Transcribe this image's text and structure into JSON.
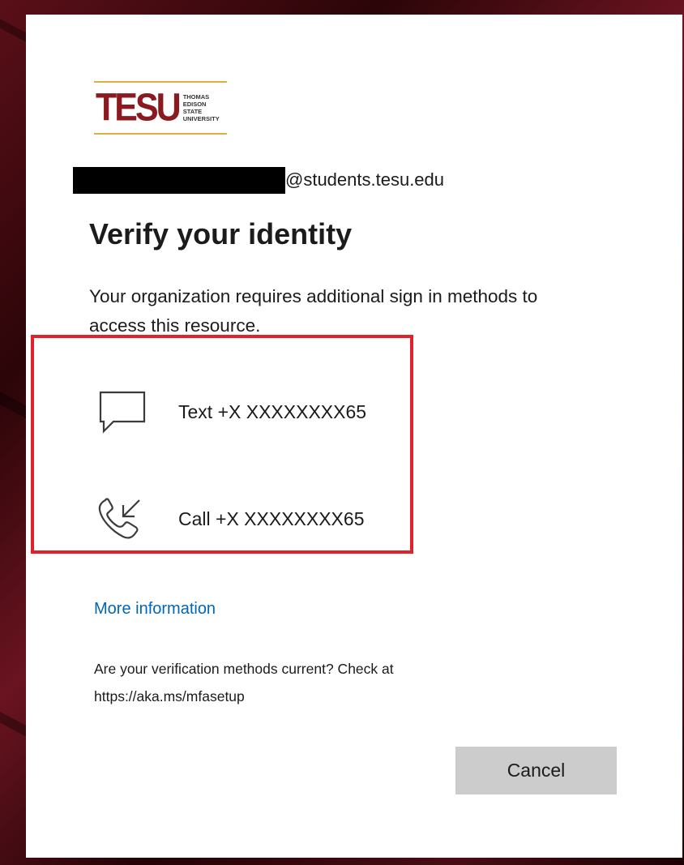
{
  "logo": {
    "main": "TESU",
    "lines": [
      "THOMAS",
      "EDISON",
      "STATE",
      "UNIVERSITY"
    ]
  },
  "account": {
    "email_suffix": "@students.tesu.edu"
  },
  "heading": "Verify your identity",
  "description": "Your organization requires additional sign in methods to access this resource.",
  "methods": [
    {
      "icon": "chat-bubble-icon",
      "label": "Text +X XXXXXXXX65"
    },
    {
      "icon": "phone-call-icon",
      "label": "Call +X XXXXXXXX65"
    }
  ],
  "links": {
    "more_info": "More information"
  },
  "note": "Are your verification methods current? Check at https://aka.ms/mfasetup",
  "buttons": {
    "cancel": "Cancel"
  },
  "colors": {
    "brand_maroon": "#8a1a1f",
    "brand_gold": "#d9b23a",
    "link_blue": "#0067b8",
    "highlight_red": "#e0232a",
    "button_gray": "#cccccc"
  }
}
